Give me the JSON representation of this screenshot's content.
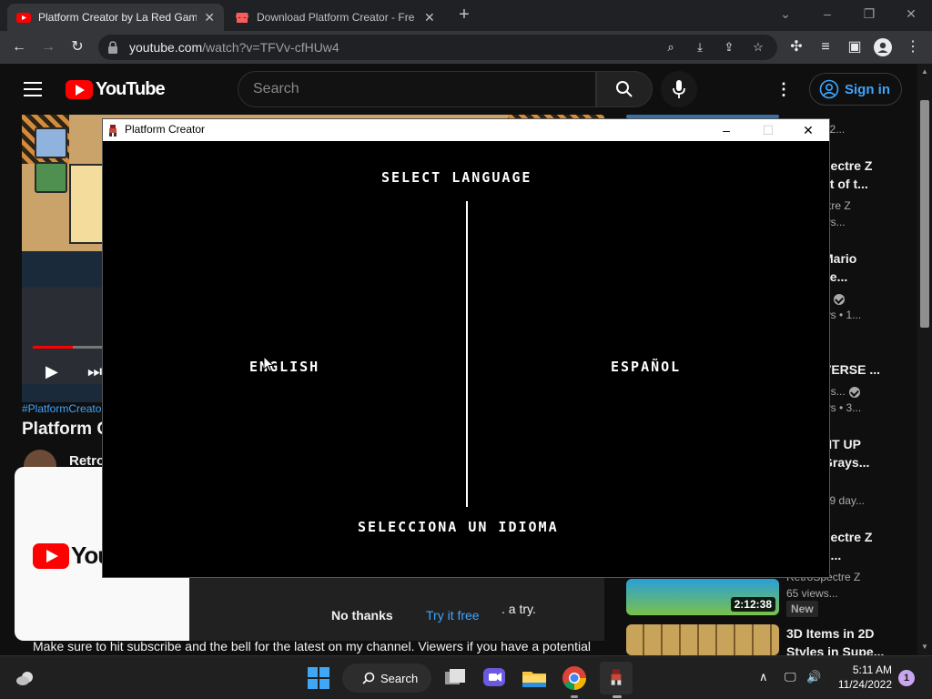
{
  "browser": {
    "tabs": [
      {
        "title": "Platform Creator by La Red Game",
        "favicon": "youtube-icon",
        "active": true
      },
      {
        "title": "Download Platform Creator - Fre",
        "favicon": "itch-icon",
        "active": false
      }
    ],
    "url_host": "youtube.com",
    "url_path": "/watch?v=TFVv-cfHUw4"
  },
  "youtube": {
    "logo_text": "YouTube",
    "search_placeholder": "Search",
    "signin_label": "Sign in",
    "hashtag": "#PlatformCreato",
    "video_title": "Platform C",
    "channel_name": "Retro",
    "promo": {
      "logo_text": "You",
      "trailing_text": ". a try.",
      "no_thanks": "No thanks",
      "try_free": "Try it free"
    },
    "description": "Make sure to hit subscribe and the bell for the latest on my channel.  Viewers if you have a potential",
    "recommendations": [
      {
        "title": [],
        "meta": [
          "• 2..."
        ]
      },
      {
        "title": [
          "pectre Z",
          "st of t..."
        ],
        "meta": [
          "ctre Z",
          "ws..."
        ]
      },
      {
        "title": [
          "Mario",
          "se..."
        ],
        "meta": [
          "",
          "ws  • 1..."
        ],
        "verified": true
      },
      {
        "title": [
          "VERSE ..."
        ],
        "meta": [
          "vis...",
          "ws  • 3..."
        ],
        "verified": true
      },
      {
        "title": [
          "HT UP",
          "Grays..."
        ],
        "meta": [
          "d",
          "• 9 day..."
        ]
      },
      {
        "title": [
          "pectre Z",
          "h..."
        ],
        "meta": [
          "RetroSpectre Z",
          "65 views..."
        ],
        "duration": "2:12:38",
        "badge": "New"
      },
      {
        "title": [
          "3D Items in 2D",
          "Styles in Supe..."
        ],
        "meta": []
      }
    ]
  },
  "app": {
    "window_title": "Platform Creator",
    "heading": "SELECT  LANGUAGE",
    "option_left": "ENGLISH",
    "option_right": "ESPAÑOL",
    "footer": "SELECCIONA  UN  IDIOMA"
  },
  "taskbar": {
    "search_label": "Search",
    "time": "5:11 AM",
    "date": "11/24/2022",
    "notification_count": "1"
  },
  "colors": {
    "youtube_red": "#ff0000",
    "link_blue": "#3ea6ff",
    "app_background": "#000000"
  }
}
